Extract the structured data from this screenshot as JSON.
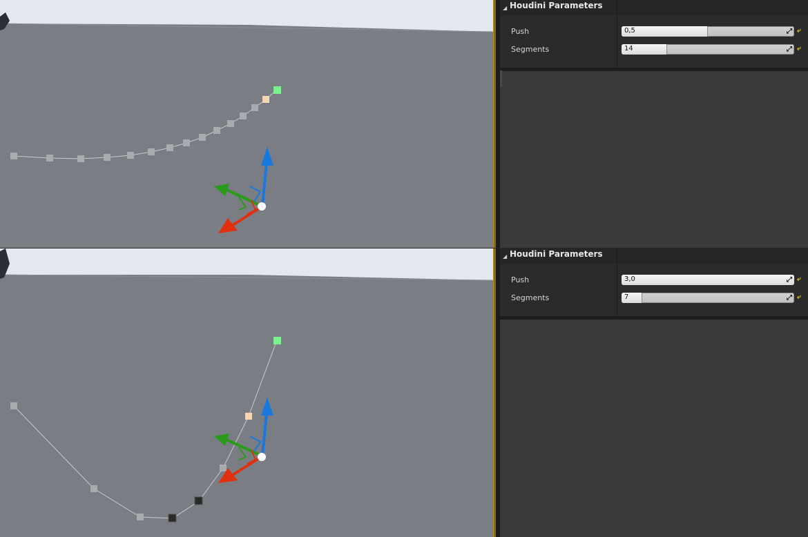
{
  "colors": {
    "sky": "#e2e8ee",
    "wall": "#7a7d84",
    "curve_point": "#a9abb0",
    "start_point": "#7bf08f",
    "selected_point": "#f8d4b0",
    "gizmo_x": "#e03010",
    "gizmo_y": "#2a9a1a",
    "gizmo_z": "#1878e0",
    "panel_bg": "#3a3a3a",
    "accent_separator": "#8a6a1c"
  },
  "panels": [
    {
      "header": {
        "title": "Houdini Parameters",
        "collapse_icon": "triangle-down-icon"
      },
      "parameters": [
        {
          "label": "Push",
          "value": "0,5",
          "fill_fraction": 0.5
        },
        {
          "label": "Segments",
          "value": "14",
          "fill_fraction": 0.26
        }
      ]
    },
    {
      "header": {
        "title": "Houdini Parameters",
        "collapse_icon": "triangle-down-icon"
      },
      "parameters": [
        {
          "label": "Push",
          "value": "3,0",
          "fill_fraction": 1.0
        },
        {
          "label": "Segments",
          "value": "7",
          "fill_fraction": 0.12
        }
      ]
    }
  ],
  "icons": {
    "expand": "⤢",
    "reset": "⤶"
  }
}
